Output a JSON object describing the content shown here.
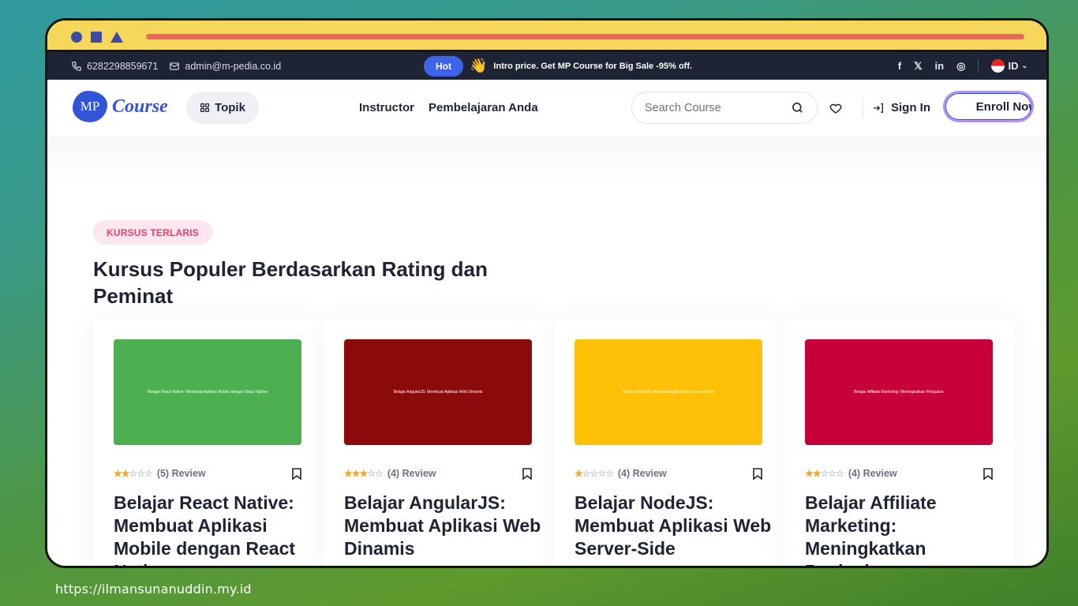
{
  "browser": {
    "accent_bar_color": "#ef6565"
  },
  "topbar": {
    "phone": "6282298859671",
    "email": "admin@m-pedia.co.id",
    "hot_badge": "Hot",
    "wave_emoji": "👋",
    "promo": "Intro price. Get MP Course for Big Sale -95% off.",
    "socials": [
      "f",
      "𝕏",
      "in",
      "◎"
    ],
    "language": "ID"
  },
  "header": {
    "logo_mark": "MP",
    "logo_text": "Course",
    "topik_label": "Topik",
    "nav": [
      "Instructor",
      "Pembelajaran Anda"
    ],
    "search_placeholder": "Search Course",
    "signin_label": "Sign In",
    "enroll_label": "Enroll Now"
  },
  "section": {
    "tag": "KURSUS TERLARIS",
    "title": "Kursus Populer Berdasarkan Rating dan Peminat"
  },
  "courses": [
    {
      "image_caption": "Belajar React Native: Membuat Aplikasi Mobile dengan React Native",
      "image_color": "#4caf50",
      "stars": 2,
      "reviews": "(5) Review",
      "title": "Belajar React Native: Membuat Aplikasi Mobile dengan React Native"
    },
    {
      "image_caption": "Belajar AngularJS: Membuat Aplikasi Web Dinamis",
      "image_color": "#8b0b0b",
      "stars": 3,
      "reviews": "(4) Review",
      "title": "Belajar AngularJS: Membuat Aplikasi Web Dinamis"
    },
    {
      "image_caption": "Belajar NodeJS: Membuat Aplikasi Web Server-Side",
      "image_color": "#ffc107",
      "stars": 1,
      "reviews": "(4) Review",
      "title": "Belajar NodeJS: Membuat Aplikasi Web Server-Side"
    },
    {
      "image_caption": "Belajar Affiliate Marketing: Meningkatkan Penjualan",
      "image_color": "#c8003a",
      "stars": 2,
      "reviews": "(4) Review",
      "title": "Belajar Affiliate Marketing: Meningkatkan Penjualan"
    }
  ],
  "caption_url": "https://ilmansunanuddin.my.id"
}
